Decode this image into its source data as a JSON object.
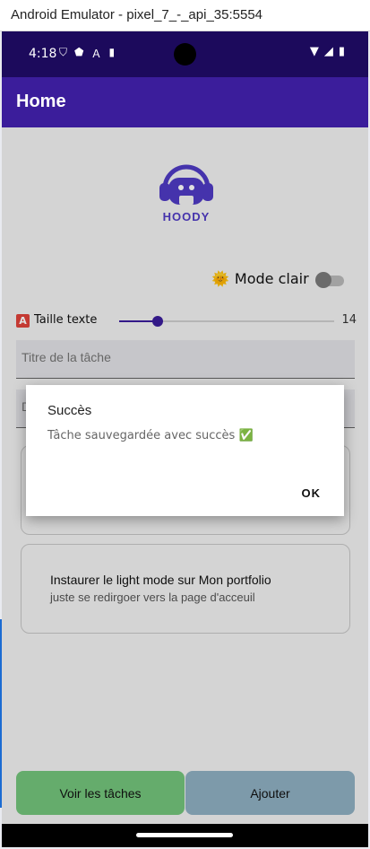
{
  "window": {
    "title": "Android Emulator - pixel_7_-_api_35:5554"
  },
  "status_bar": {
    "time": "4:18",
    "left_icons": [
      "shield-icon",
      "protect-icon",
      "a-icon",
      "sd-card-icon"
    ],
    "right_icons": [
      "wifi-icon",
      "signal-icon",
      "battery-icon"
    ]
  },
  "app_bar": {
    "title": "Home"
  },
  "logo": {
    "text": "HOODY"
  },
  "theme_toggle": {
    "emoji": "🌞",
    "label": "Mode clair",
    "enabled": false
  },
  "text_size": {
    "icon": "A",
    "label": "Taille texte",
    "value": "14",
    "fraction": 0.18
  },
  "inputs": {
    "title_placeholder": "Titre de la tâche",
    "description_placeholder": "Description"
  },
  "tasks": [
    {
      "title": "",
      "description": ""
    },
    {
      "title": "Instaurer le light mode sur Mon portfolio",
      "description": "juste se redirgoer vers la page d'acceuil"
    }
  ],
  "buttons": {
    "view_tasks": "Voir les tâches",
    "add": "Ajouter"
  },
  "dialog": {
    "title": "Succès",
    "message": "Tâche sauvegardée avec succès ✅",
    "ok": "OK"
  },
  "colors": {
    "primary": "#3b1d9b",
    "status_bar": "#1c0a5c",
    "view_button": "#74c47b",
    "add_button": "#8fb0c2"
  }
}
